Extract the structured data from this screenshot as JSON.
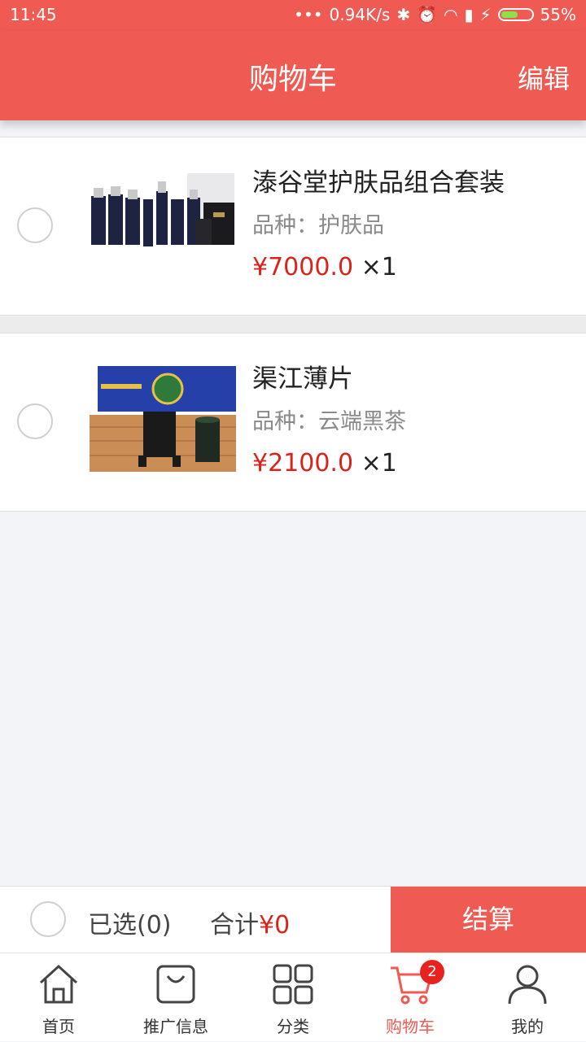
{
  "status_bar": {
    "time": "11:45",
    "speed": "0.94K/s",
    "battery": "55%",
    "battery_level": 0.55
  },
  "header": {
    "title": "购物车",
    "edit_label": "编辑"
  },
  "cart_items": [
    {
      "name": "溙谷堂护肤品组合套装",
      "variant": "品种：护肤品",
      "price": "¥7000.0",
      "quantity": "×1"
    },
    {
      "name": "渠江薄片",
      "variant": "品种：云端黑茶",
      "price": "¥2100.0",
      "quantity": "×1"
    }
  ],
  "footer": {
    "selected": "已选(0)",
    "total_label": "合计",
    "total_value": "¥0",
    "checkout_label": "结算"
  },
  "tabbar": {
    "tabs": [
      {
        "label": "首页",
        "icon": "home-icon"
      },
      {
        "label": "推广信息",
        "icon": "bag-icon"
      },
      {
        "label": "分类",
        "icon": "grid-icon"
      },
      {
        "label": "购物车",
        "icon": "cart-icon",
        "badge": "2"
      },
      {
        "label": "我的",
        "icon": "user-icon"
      }
    ],
    "active": "购物车"
  },
  "colors": {
    "accent": "#ef5a53",
    "price": "#d9231b"
  }
}
